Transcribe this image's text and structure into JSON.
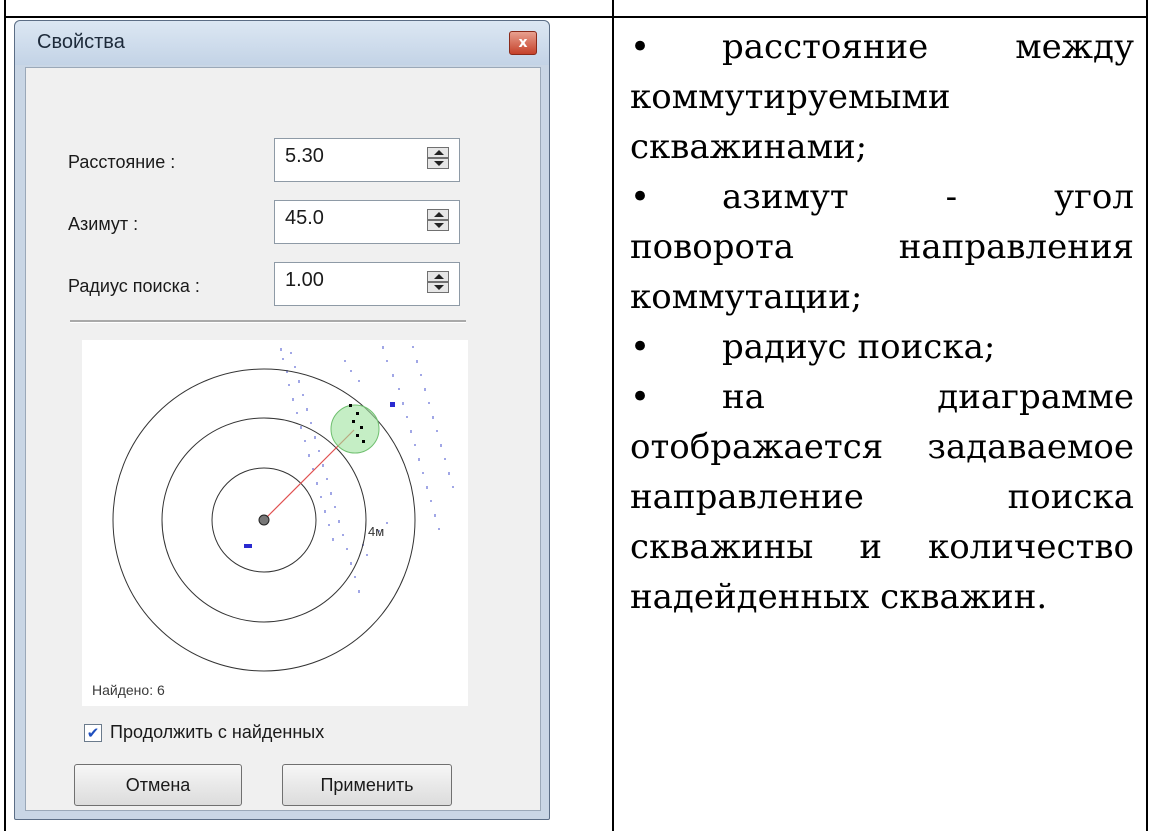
{
  "dialog": {
    "title": "Свойства",
    "close_label": "x",
    "fields": [
      {
        "label": "Расстояние :",
        "value": "5.30"
      },
      {
        "label": "Азимут :",
        "value": "45.0"
      },
      {
        "label": "Радиус поиска :",
        "value": "1.00"
      }
    ],
    "diagram": {
      "scale_label": "4м",
      "found_text": "Найдено: 6"
    },
    "checkbox": {
      "label": "Продолжить с найденных",
      "checked": true
    },
    "buttons": {
      "cancel": "Отмена",
      "apply": "Применить"
    }
  },
  "bullets": [
    {
      "text": "расстояние между коммутируемыми скважинами;"
    },
    {
      "text": "азимут - угол поворота направления коммутации;"
    },
    {
      "text": "радиус поиска;"
    },
    {
      "text": "на диаграмме отображается задаваемое направление поиска скважины и количество надейденных скважин."
    }
  ]
}
